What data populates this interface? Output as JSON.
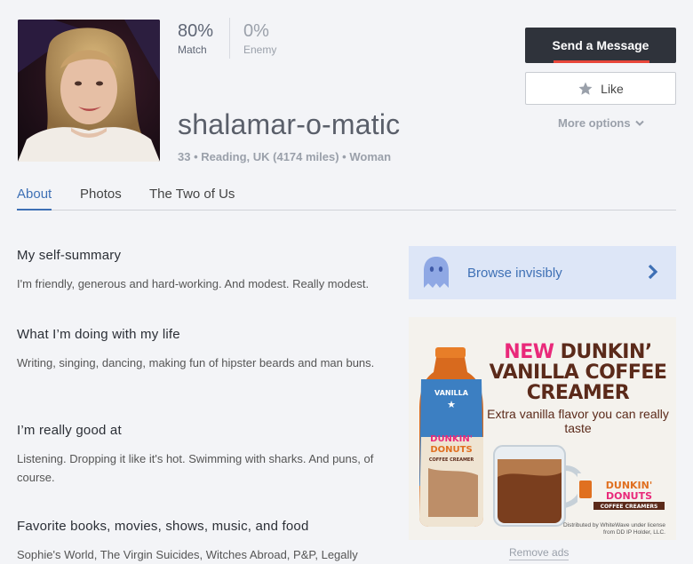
{
  "profile": {
    "match_percent": "80%",
    "match_label": "Match",
    "enemy_percent": "0%",
    "enemy_label": "Enemy",
    "username": "shalamar-o-matic",
    "info": "33 • Reading, UK  (4174 miles) • Woman"
  },
  "actions": {
    "send_message": "Send a Message",
    "like": "Like",
    "more_options": "More options",
    "accent_color": "#e8463a"
  },
  "tabs": [
    {
      "label": "About",
      "active": true
    },
    {
      "label": "Photos",
      "active": false
    },
    {
      "label": "The Two of Us",
      "active": false
    }
  ],
  "essays": [
    {
      "title": "My self-summary",
      "text": "I'm friendly, generous and hard-working. And modest. Really modest."
    },
    {
      "title": "What I’m doing with my life",
      "text": "Writing, singing, dancing, making fun of hipster beards and man buns."
    },
    {
      "title": "I’m really good at",
      "text": "Listening. Dropping it like it's hot. Swimming with sharks. And puns, of course."
    },
    {
      "title": "Favorite books, movies, shows, music, and food",
      "text": "Sophie's World, The Virgin Suicides, Witches Abroad, P&P, Legally"
    }
  ],
  "sidebar": {
    "browse_invisibly": "Browse invisibly",
    "remove_ads": "Remove ads"
  },
  "ad": {
    "headline_new": "NEW",
    "headline_brand": "DUNKIN’",
    "headline_line2": "VANILLA COFFEE",
    "headline_line3": "CREAMER",
    "subline": "Extra vanilla flavor you can really taste",
    "bottle_label_top": "VANILLA",
    "bottle_brand_1": "DUNKIN'",
    "bottle_brand_2": "DONUTS",
    "bottle_product": "COFFEE CREAMER",
    "logo_brand_1": "DUNKIN'",
    "logo_brand_2": "DONUTS",
    "logo_product": "COFFEE CREAMERS",
    "legal": "Distributed by WhiteWave under license from DD IP Holder, LLC."
  }
}
